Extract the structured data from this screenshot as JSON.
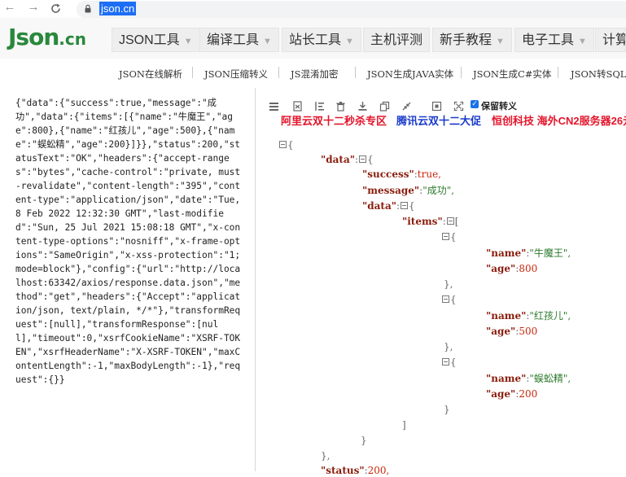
{
  "browser": {
    "back_icon": "arrow-left-icon",
    "forward_icon": "arrow-right-icon",
    "reload_icon": "reload-icon",
    "url": "json.cn"
  },
  "site": {
    "logo_main": "Json",
    "logo_suffix": ".cn",
    "brand_color": "#29883c"
  },
  "menu": [
    {
      "label": "JSON工具",
      "caret": true
    },
    {
      "label": "编译工具",
      "caret": true
    },
    {
      "label": "站长工具",
      "caret": true
    },
    {
      "label": "主机评测",
      "caret": false
    },
    {
      "label": "新手教程",
      "caret": true
    },
    {
      "label": "电子工具",
      "caret": true
    },
    {
      "label": "计算",
      "caret": false
    }
  ],
  "subnav": [
    "JSON在线解析",
    "JSON压缩转义",
    "JS混淆加密",
    "JSON生成JAVA实体",
    "JSON生成C#实体",
    "JSON转SQL"
  ],
  "raw_json": "{\"data\":{\"success\":true,\"message\":\"成功\",\"data\":{\"items\":[{\"name\":\"牛魔王\",\"age\":800},{\"name\":\"红孩儿\",\"age\":500},{\"name\":\"蜈蚣精\",\"age\":200}]}},\"status\":200,\"statusText\":\"OK\",\"headers\":{\"accept-ranges\":\"bytes\",\"cache-control\":\"private, must-revalidate\",\"content-length\":\"395\",\"content-type\":\"application/json\",\"date\":\"Tue, 8 Feb 2022 12:32:30 GMT\",\"last-modified\":\"Sun, 25 Jul 2021 15:08:18 GMT\",\"x-content-type-options\":\"nosniff\",\"x-frame-options\":\"SameOrigin\",\"x-xss-protection\":\"1; mode=block\"},\"config\":{\"url\":\"http://localhost:63342/axios/response.data.json\",\"method\":\"get\",\"headers\":{\"Accept\":\"application/json, text/plain, */*\"},\"transformRequest\":[null],\"transformResponse\":[null],\"timeout\":0,\"xsrfCookieName\":\"XSRF-TOKEN\",\"xsrfHeaderName\":\"X-XSRF-TOKEN\",\"maxContentLength\":-1,\"maxBodyLength\":-1},\"request\":{}}",
  "toolbar": {
    "icons": [
      "list-icon",
      "document-icon",
      "indent-icon",
      "trash-icon",
      "download-icon",
      "copy-icon",
      "compress-icon",
      "collapse-icon",
      "expand-icon"
    ],
    "escape_checkbox_label": "保留转义",
    "escape_checked": true
  },
  "ads": [
    "阿里云双十二秒杀专区",
    "腾讯云双十二大促",
    "恒创科技 海外CN2服务器26元"
  ],
  "tree": {
    "data_key": "\"data\"",
    "success_key": "\"success\"",
    "success_val": "true,",
    "message_key": "\"message\"",
    "message_val": "\"成功\",",
    "inner_data_key": "\"data\"",
    "items_key": "\"items\"",
    "name_key": "\"name\"",
    "age_key": "\"age\"",
    "item1_name": "\"牛魔王\",",
    "item1_age": "800",
    "item2_name": "\"红孩儿\",",
    "item2_age": "500",
    "item3_name": "\"蜈蚣精\",",
    "item3_age": "200",
    "status_key": "\"status\"",
    "status_val": "200,"
  },
  "colors": {
    "key": "#8a1c0c",
    "string": "#2d7a2d",
    "number": "#c9260c",
    "ad_red": "#e3152b",
    "ad_blue": "#1a3bcb"
  }
}
